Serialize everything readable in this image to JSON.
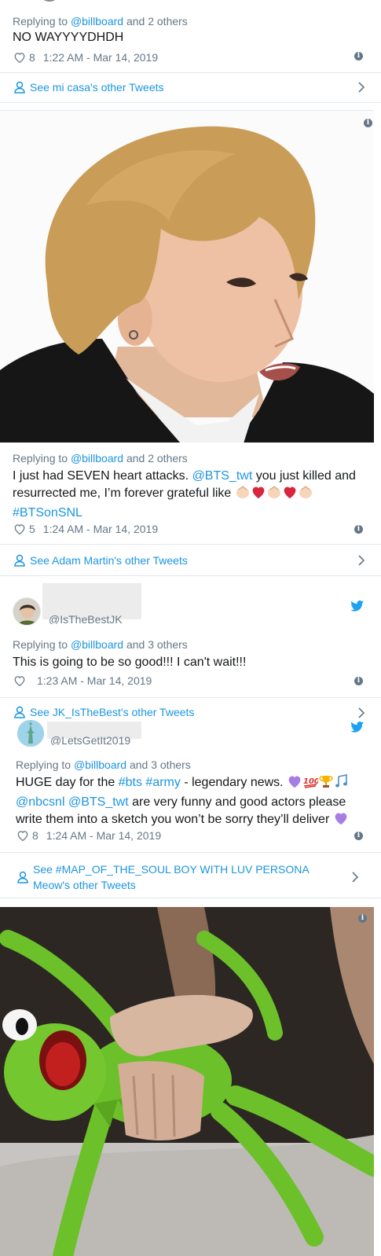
{
  "tweet1": {
    "reply_prefix": "Replying to ",
    "reply_mention": "@billboard",
    "reply_suffix": " and 2 others",
    "text": "NO WAYYYYDHDH",
    "likes": "8",
    "time": "1:22 AM - Mar 14, 2019",
    "see_more": "See mi casa's other Tweets"
  },
  "tweet2": {
    "reply_prefix": "Replying to ",
    "reply_mention": "@billboard",
    "reply_suffix": " and 2 others",
    "text_a": "I just had SEVEN heart attacks. ",
    "mention": "@BTS_twt",
    "text_b": " you just killed and resurrected me, I’m forever grateful like ",
    "hashtag": "#BTSonSNL",
    "likes": "5",
    "time": "1:24 AM - Mar 14, 2019",
    "see_more": "See Adam Martin's other Tweets"
  },
  "tweet3": {
    "handle": "@IsTheBestJK",
    "reply_prefix": "Replying to ",
    "reply_mention": "@billboard",
    "reply_suffix": " and 3 others",
    "text": "This is going to be so good!!! I can't wait!!!",
    "time": "1:23 AM - Mar 14, 2019",
    "see_more": "See JK_IsTheBest's other Tweets"
  },
  "tweet4": {
    "handle": "@LetsGetIt2019",
    "reply_prefix": "Replying to ",
    "reply_mention": "@billboard",
    "reply_suffix": " and 3 others",
    "text_a": "HUGE day for the ",
    "hashtag1": "#bts",
    "hashtag2": "#army",
    "text_b": " - legendary news. ",
    "mention1": "@nbcsnl",
    "mention2": "@BTS_twt",
    "text_c": " are very funny and good actors please write them into a sketch you won’t be sorry they’ll deliver ",
    "likes": "8",
    "time": "1:24 AM - Mar 14, 2019",
    "see_more": "See #MAP_OF_THE_SOUL BOY WITH LUV PERSONA Meow's other Tweets"
  },
  "icons": {
    "info": "i"
  },
  "colors": {
    "link": "#1b95e0",
    "muted": "#657786",
    "divider": "#e1e8ed",
    "heart_red": "#d7263d",
    "kermit_green": "#6cc12a"
  }
}
